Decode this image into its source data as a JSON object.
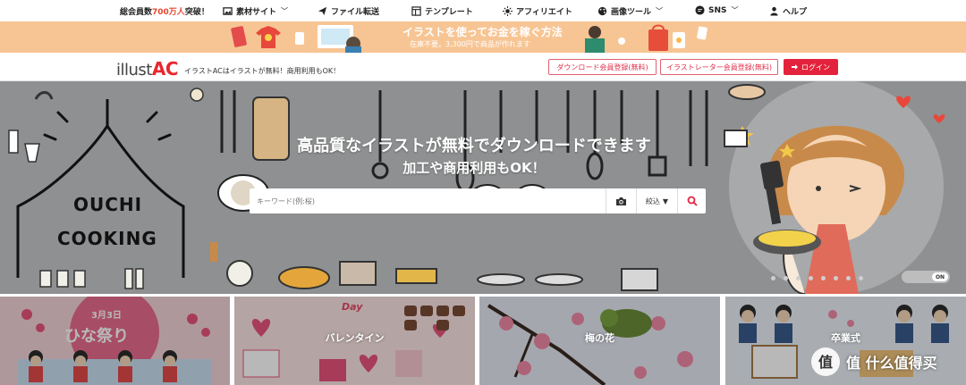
{
  "topbar": {
    "total_prefix": "総会員数",
    "total_number": "700万人",
    "total_suffix": "突破！",
    "nav": [
      {
        "label": "素材サイト",
        "icon": "image-icon",
        "dropdown": true
      },
      {
        "label": "ファイル転送",
        "icon": "paper-plane-icon",
        "dropdown": false
      },
      {
        "label": "テンプレート",
        "icon": "template-icon",
        "dropdown": false
      },
      {
        "label": "アフィリエイト",
        "icon": "sun-icon",
        "dropdown": false
      },
      {
        "label": "画像ツール",
        "icon": "palette-icon",
        "dropdown": true
      },
      {
        "label": "SNS",
        "icon": "chat-icon",
        "dropdown": true
      },
      {
        "label": "ヘルプ",
        "icon": "user-icon",
        "dropdown": false
      }
    ]
  },
  "promo": {
    "title": "イラストを使ってお金を稼ぐ方法",
    "subtitle": "在庫不要。3,300円で商品が作れます"
  },
  "header": {
    "logo_text": "illust",
    "logo_accent": "AC",
    "tagline": "イラストACはイラストが無料！商用利用もOK！",
    "download_register": "ダウンロード会員登録(無料)",
    "creator_register": "イラストレーター会員登録(無料)",
    "login": "ログイン"
  },
  "hero": {
    "headline": "高品質なイラストが無料でダウンロードできます",
    "subheadline": "加工や商用利用もOK！",
    "art_text_line1": "OUCHI",
    "art_text_line2": "COOKING",
    "search_placeholder": "キーワード(例:桜)",
    "filter_label": "絞込",
    "toggle_label": "ON",
    "carousel_count": 8
  },
  "cards": [
    {
      "label": "ひなまつり",
      "banner": "3月3日",
      "banner_big": "ひな祭り"
    },
    {
      "label": "バレンタイン",
      "banner": "Day"
    },
    {
      "label": "梅の花"
    },
    {
      "label": "卒業式"
    }
  ],
  "watermark": {
    "text": "值 什么值得买"
  },
  "colors": {
    "accent": "#e3233b",
    "promo": "#f7c594",
    "hero_bg": "#8d8e8f"
  }
}
